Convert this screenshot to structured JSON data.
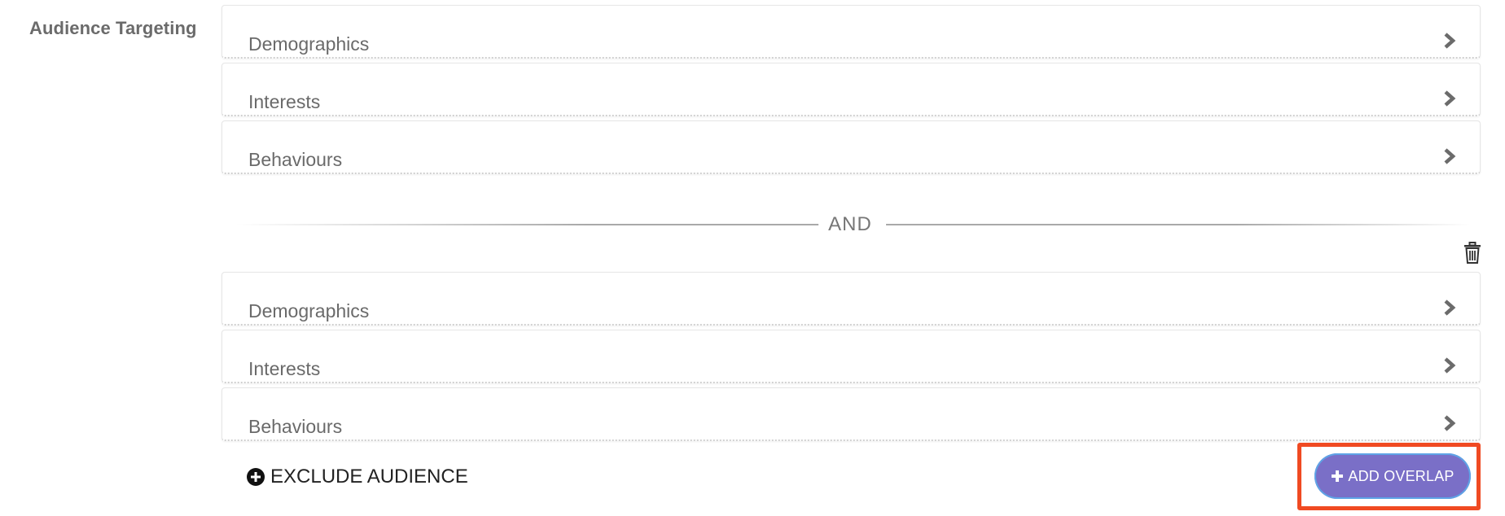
{
  "section": {
    "label": "Audience Targeting"
  },
  "group1": {
    "rows": [
      {
        "label": "Demographics"
      },
      {
        "label": "Interests"
      },
      {
        "label": "Behaviours"
      }
    ]
  },
  "divider": {
    "label": "AND"
  },
  "group2": {
    "rows": [
      {
        "label": "Demographics"
      },
      {
        "label": "Interests"
      },
      {
        "label": "Behaviours"
      }
    ]
  },
  "actions": {
    "exclude_label": "EXCLUDE AUDIENCE",
    "add_overlap_label": "ADD OVERLAP"
  },
  "colors": {
    "accent": "#7a6fc7",
    "highlight": "#f04a22"
  },
  "icons": [
    "chevron-right-icon",
    "trash-icon",
    "plus-circle-icon",
    "plus-icon"
  ]
}
